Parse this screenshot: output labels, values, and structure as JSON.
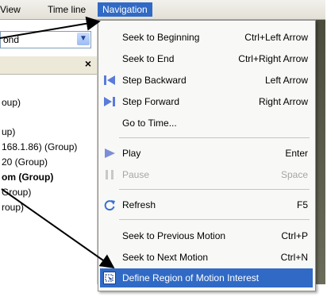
{
  "menubar": {
    "view": "View",
    "timeline": "Time line",
    "navigation": "Navigation"
  },
  "left_panel": {
    "combo_text": "ond",
    "close_glyph": "×",
    "tree": [
      "oup)",
      "up)",
      "168.1.86) (Group)",
      "20 (Group)",
      "om (Group)",
      "Group)",
      "roup)"
    ]
  },
  "menu": {
    "seek_beginning": {
      "label": "Seek to Beginning",
      "shortcut": "Ctrl+Left Arrow"
    },
    "seek_end": {
      "label": "Seek to End",
      "shortcut": "Ctrl+Right Arrow"
    },
    "step_backward": {
      "label": "Step Backward",
      "shortcut": "Left Arrow",
      "icon": "step-backward-icon"
    },
    "step_forward": {
      "label": "Step Forward",
      "shortcut": "Right Arrow",
      "icon": "step-forward-icon"
    },
    "go_to_time": {
      "label": "Go to Time..."
    },
    "play": {
      "label": "Play",
      "shortcut": "Enter",
      "icon": "play-icon"
    },
    "pause": {
      "label": "Pause",
      "shortcut": "Space",
      "icon": "pause-icon",
      "disabled": true
    },
    "refresh": {
      "label": "Refresh",
      "shortcut": "F5",
      "icon": "refresh-icon"
    },
    "seek_prev_motion": {
      "label": "Seek to Previous Motion",
      "shortcut": "Ctrl+P"
    },
    "seek_next_motion": {
      "label": "Seek to Next Motion",
      "shortcut": "Ctrl+N"
    },
    "define_region": {
      "label": "Define Region of Motion Interest",
      "icon": "region-icon",
      "highlighted": true
    }
  },
  "colors": {
    "highlight": "#316ac5",
    "disabled_text": "#a6a6a6",
    "icon_blue": "#5a7bd8"
  }
}
